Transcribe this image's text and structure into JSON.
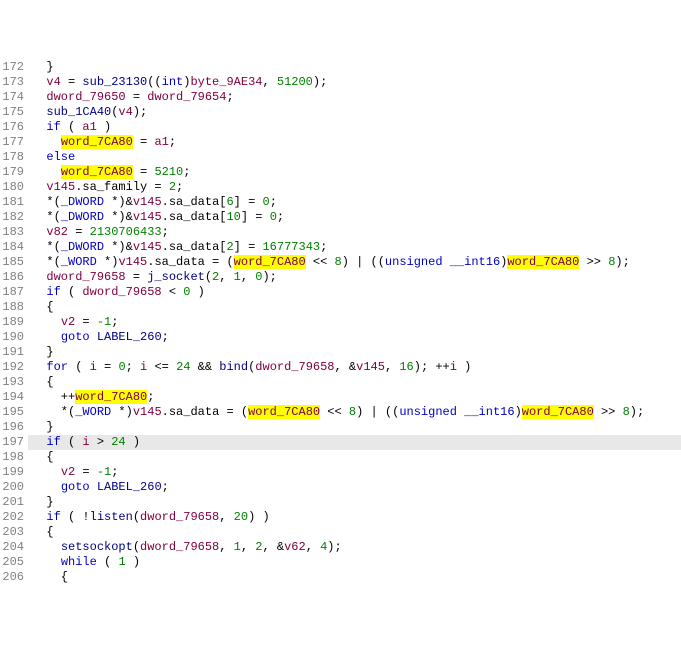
{
  "lines": [
    {
      "n": 172,
      "tokens": [
        {
          "t": "  }",
          "c": ""
        }
      ]
    },
    {
      "n": 173,
      "tokens": [
        {
          "t": "  ",
          "c": ""
        },
        {
          "t": "v4",
          "c": "var"
        },
        {
          "t": " = ",
          "c": ""
        },
        {
          "t": "sub_23130",
          "c": "fn"
        },
        {
          "t": "((",
          "c": ""
        },
        {
          "t": "int",
          "c": "type"
        },
        {
          "t": ")",
          "c": ""
        },
        {
          "t": "byte_9AE34",
          "c": "glob"
        },
        {
          "t": ", ",
          "c": ""
        },
        {
          "t": "51200",
          "c": "num"
        },
        {
          "t": ");",
          "c": ""
        }
      ]
    },
    {
      "n": 174,
      "tokens": [
        {
          "t": "  ",
          "c": ""
        },
        {
          "t": "dword_79650",
          "c": "glob"
        },
        {
          "t": " = ",
          "c": ""
        },
        {
          "t": "dword_79654",
          "c": "glob"
        },
        {
          "t": ";",
          "c": ""
        }
      ]
    },
    {
      "n": 175,
      "tokens": [
        {
          "t": "  ",
          "c": ""
        },
        {
          "t": "sub_1CA40",
          "c": "fn"
        },
        {
          "t": "(",
          "c": ""
        },
        {
          "t": "v4",
          "c": "var"
        },
        {
          "t": ");",
          "c": ""
        }
      ]
    },
    {
      "n": 176,
      "tokens": [
        {
          "t": "  ",
          "c": ""
        },
        {
          "t": "if",
          "c": "kw"
        },
        {
          "t": " ( ",
          "c": ""
        },
        {
          "t": "a1",
          "c": "var"
        },
        {
          "t": " )",
          "c": ""
        }
      ]
    },
    {
      "n": 177,
      "tokens": [
        {
          "t": "    ",
          "c": ""
        },
        {
          "t": "word_7CA80",
          "c": "glob hl"
        },
        {
          "t": " = ",
          "c": ""
        },
        {
          "t": "a1",
          "c": "var"
        },
        {
          "t": ";",
          "c": ""
        }
      ]
    },
    {
      "n": 178,
      "tokens": [
        {
          "t": "  ",
          "c": ""
        },
        {
          "t": "else",
          "c": "kw"
        }
      ]
    },
    {
      "n": 179,
      "tokens": [
        {
          "t": "    ",
          "c": ""
        },
        {
          "t": "word_7CA80",
          "c": "glob hl"
        },
        {
          "t": " = ",
          "c": ""
        },
        {
          "t": "5210",
          "c": "num"
        },
        {
          "t": ";",
          "c": ""
        }
      ]
    },
    {
      "n": 180,
      "tokens": [
        {
          "t": "  ",
          "c": ""
        },
        {
          "t": "v145",
          "c": "var"
        },
        {
          "t": ".sa_family = ",
          "c": ""
        },
        {
          "t": "2",
          "c": "num"
        },
        {
          "t": ";",
          "c": ""
        }
      ]
    },
    {
      "n": 181,
      "tokens": [
        {
          "t": "  *(",
          "c": ""
        },
        {
          "t": "_DWORD",
          "c": "type"
        },
        {
          "t": " *)&",
          "c": ""
        },
        {
          "t": "v145",
          "c": "var"
        },
        {
          "t": ".sa_data[",
          "c": ""
        },
        {
          "t": "6",
          "c": "num"
        },
        {
          "t": "] = ",
          "c": ""
        },
        {
          "t": "0",
          "c": "num"
        },
        {
          "t": ";",
          "c": ""
        }
      ]
    },
    {
      "n": 182,
      "tokens": [
        {
          "t": "  *(",
          "c": ""
        },
        {
          "t": "_DWORD",
          "c": "type"
        },
        {
          "t": " *)&",
          "c": ""
        },
        {
          "t": "v145",
          "c": "var"
        },
        {
          "t": ".sa_data[",
          "c": ""
        },
        {
          "t": "10",
          "c": "num"
        },
        {
          "t": "] = ",
          "c": ""
        },
        {
          "t": "0",
          "c": "num"
        },
        {
          "t": ";",
          "c": ""
        }
      ]
    },
    {
      "n": 183,
      "tokens": [
        {
          "t": "  ",
          "c": ""
        },
        {
          "t": "v82",
          "c": "var"
        },
        {
          "t": " = ",
          "c": ""
        },
        {
          "t": "2130706433",
          "c": "num"
        },
        {
          "t": ";",
          "c": ""
        }
      ]
    },
    {
      "n": 184,
      "tokens": [
        {
          "t": "  *(",
          "c": ""
        },
        {
          "t": "_DWORD",
          "c": "type"
        },
        {
          "t": " *)&",
          "c": ""
        },
        {
          "t": "v145",
          "c": "var"
        },
        {
          "t": ".sa_data[",
          "c": ""
        },
        {
          "t": "2",
          "c": "num"
        },
        {
          "t": "] = ",
          "c": ""
        },
        {
          "t": "16777343",
          "c": "num"
        },
        {
          "t": ";",
          "c": ""
        }
      ]
    },
    {
      "n": 185,
      "tokens": [
        {
          "t": "  *(",
          "c": ""
        },
        {
          "t": "_WORD",
          "c": "type"
        },
        {
          "t": " *)",
          "c": ""
        },
        {
          "t": "v145",
          "c": "var"
        },
        {
          "t": ".sa_data = (",
          "c": ""
        },
        {
          "t": "word_7CA80",
          "c": "glob hl"
        },
        {
          "t": " << ",
          "c": ""
        },
        {
          "t": "8",
          "c": "num"
        },
        {
          "t": ") | ((",
          "c": ""
        },
        {
          "t": "unsigned",
          "c": "type"
        },
        {
          "t": " ",
          "c": ""
        },
        {
          "t": "__int16",
          "c": "type"
        },
        {
          "t": ")",
          "c": ""
        },
        {
          "t": "word_7CA80",
          "c": "glob hl"
        },
        {
          "t": " >> ",
          "c": ""
        },
        {
          "t": "8",
          "c": "num"
        },
        {
          "t": ");",
          "c": ""
        }
      ]
    },
    {
      "n": 186,
      "tokens": [
        {
          "t": "  ",
          "c": ""
        },
        {
          "t": "dword_79658",
          "c": "glob"
        },
        {
          "t": " = ",
          "c": ""
        },
        {
          "t": "j_socket",
          "c": "fn"
        },
        {
          "t": "(",
          "c": ""
        },
        {
          "t": "2",
          "c": "num"
        },
        {
          "t": ", ",
          "c": ""
        },
        {
          "t": "1",
          "c": "num"
        },
        {
          "t": ", ",
          "c": ""
        },
        {
          "t": "0",
          "c": "num"
        },
        {
          "t": ");",
          "c": ""
        }
      ]
    },
    {
      "n": 187,
      "tokens": [
        {
          "t": "  ",
          "c": ""
        },
        {
          "t": "if",
          "c": "kw"
        },
        {
          "t": " ( ",
          "c": ""
        },
        {
          "t": "dword_79658",
          "c": "glob"
        },
        {
          "t": " < ",
          "c": ""
        },
        {
          "t": "0",
          "c": "num"
        },
        {
          "t": " )",
          "c": ""
        }
      ]
    },
    {
      "n": 188,
      "tokens": [
        {
          "t": "  {",
          "c": ""
        }
      ]
    },
    {
      "n": 189,
      "tokens": [
        {
          "t": "    ",
          "c": ""
        },
        {
          "t": "v2",
          "c": "var"
        },
        {
          "t": " = ",
          "c": ""
        },
        {
          "t": "-1",
          "c": "num"
        },
        {
          "t": ";",
          "c": ""
        }
      ]
    },
    {
      "n": 190,
      "tokens": [
        {
          "t": "    ",
          "c": ""
        },
        {
          "t": "goto",
          "c": "kw"
        },
        {
          "t": " ",
          "c": ""
        },
        {
          "t": "LABEL_260",
          "c": "fn"
        },
        {
          "t": ";",
          "c": ""
        }
      ]
    },
    {
      "n": 191,
      "tokens": [
        {
          "t": "  }",
          "c": ""
        }
      ]
    },
    {
      "n": 192,
      "tokens": [
        {
          "t": "  ",
          "c": ""
        },
        {
          "t": "for",
          "c": "kw"
        },
        {
          "t": " ( ",
          "c": ""
        },
        {
          "t": "i",
          "c": "var"
        },
        {
          "t": " = ",
          "c": ""
        },
        {
          "t": "0",
          "c": "num"
        },
        {
          "t": "; ",
          "c": ""
        },
        {
          "t": "i",
          "c": "var"
        },
        {
          "t": " <= ",
          "c": ""
        },
        {
          "t": "24",
          "c": "num"
        },
        {
          "t": " && ",
          "c": ""
        },
        {
          "t": "bind",
          "c": "fn"
        },
        {
          "t": "(",
          "c": ""
        },
        {
          "t": "dword_79658",
          "c": "glob"
        },
        {
          "t": ", &",
          "c": ""
        },
        {
          "t": "v145",
          "c": "var"
        },
        {
          "t": ", ",
          "c": ""
        },
        {
          "t": "16",
          "c": "num"
        },
        {
          "t": "); ++",
          "c": ""
        },
        {
          "t": "i",
          "c": "var"
        },
        {
          "t": " )",
          "c": ""
        }
      ]
    },
    {
      "n": 193,
      "tokens": [
        {
          "t": "  {",
          "c": ""
        }
      ]
    },
    {
      "n": 194,
      "tokens": [
        {
          "t": "    ++",
          "c": ""
        },
        {
          "t": "word_7CA80",
          "c": "glob hl"
        },
        {
          "t": ";",
          "c": ""
        }
      ]
    },
    {
      "n": 195,
      "tokens": [
        {
          "t": "    *(",
          "c": ""
        },
        {
          "t": "_WORD",
          "c": "type"
        },
        {
          "t": " *)",
          "c": ""
        },
        {
          "t": "v145",
          "c": "var"
        },
        {
          "t": ".sa_data = (",
          "c": ""
        },
        {
          "t": "word_7CA80",
          "c": "glob hl"
        },
        {
          "t": " << ",
          "c": ""
        },
        {
          "t": "8",
          "c": "num"
        },
        {
          "t": ") | ((",
          "c": ""
        },
        {
          "t": "unsigned",
          "c": "type"
        },
        {
          "t": " ",
          "c": ""
        },
        {
          "t": "__int16",
          "c": "type"
        },
        {
          "t": ")",
          "c": ""
        },
        {
          "t": "word_7CA80",
          "c": "glob hl"
        },
        {
          "t": " >> ",
          "c": ""
        },
        {
          "t": "8",
          "c": "num"
        },
        {
          "t": ");",
          "c": ""
        }
      ]
    },
    {
      "n": 196,
      "tokens": [
        {
          "t": "  }",
          "c": ""
        }
      ]
    },
    {
      "n": 197,
      "current": true,
      "tokens": [
        {
          "t": "  ",
          "c": ""
        },
        {
          "t": "if",
          "c": "kw"
        },
        {
          "t": " ( ",
          "c": ""
        },
        {
          "t": "i",
          "c": "var"
        },
        {
          "t": " > ",
          "c": ""
        },
        {
          "t": "24",
          "c": "num"
        },
        {
          "t": " )",
          "c": ""
        }
      ]
    },
    {
      "n": 198,
      "tokens": [
        {
          "t": "  {",
          "c": ""
        }
      ]
    },
    {
      "n": 199,
      "tokens": [
        {
          "t": "    ",
          "c": ""
        },
        {
          "t": "v2",
          "c": "var"
        },
        {
          "t": " = ",
          "c": ""
        },
        {
          "t": "-1",
          "c": "num"
        },
        {
          "t": ";",
          "c": ""
        }
      ]
    },
    {
      "n": 200,
      "tokens": [
        {
          "t": "    ",
          "c": ""
        },
        {
          "t": "goto",
          "c": "kw"
        },
        {
          "t": " ",
          "c": ""
        },
        {
          "t": "LABEL_260",
          "c": "fn"
        },
        {
          "t": ";",
          "c": ""
        }
      ]
    },
    {
      "n": 201,
      "tokens": [
        {
          "t": "  }",
          "c": ""
        }
      ]
    },
    {
      "n": 202,
      "tokens": [
        {
          "t": "  ",
          "c": ""
        },
        {
          "t": "if",
          "c": "kw"
        },
        {
          "t": " ( !",
          "c": ""
        },
        {
          "t": "listen",
          "c": "fn"
        },
        {
          "t": "(",
          "c": ""
        },
        {
          "t": "dword_79658",
          "c": "glob"
        },
        {
          "t": ", ",
          "c": ""
        },
        {
          "t": "20",
          "c": "num"
        },
        {
          "t": ") )",
          "c": ""
        }
      ]
    },
    {
      "n": 203,
      "tokens": [
        {
          "t": "  {",
          "c": ""
        }
      ]
    },
    {
      "n": 204,
      "tokens": [
        {
          "t": "    ",
          "c": ""
        },
        {
          "t": "setsockopt",
          "c": "fn"
        },
        {
          "t": "(",
          "c": ""
        },
        {
          "t": "dword_79658",
          "c": "glob"
        },
        {
          "t": ", ",
          "c": ""
        },
        {
          "t": "1",
          "c": "num"
        },
        {
          "t": ", ",
          "c": ""
        },
        {
          "t": "2",
          "c": "num"
        },
        {
          "t": ", &",
          "c": ""
        },
        {
          "t": "v62",
          "c": "var"
        },
        {
          "t": ", ",
          "c": ""
        },
        {
          "t": "4",
          "c": "num"
        },
        {
          "t": ");",
          "c": ""
        }
      ]
    },
    {
      "n": 205,
      "tokens": [
        {
          "t": "    ",
          "c": ""
        },
        {
          "t": "while",
          "c": "kw"
        },
        {
          "t": " ( ",
          "c": ""
        },
        {
          "t": "1",
          "c": "num"
        },
        {
          "t": " )",
          "c": ""
        }
      ]
    },
    {
      "n": 206,
      "tokens": [
        {
          "t": "    {",
          "c": ""
        }
      ]
    }
  ]
}
